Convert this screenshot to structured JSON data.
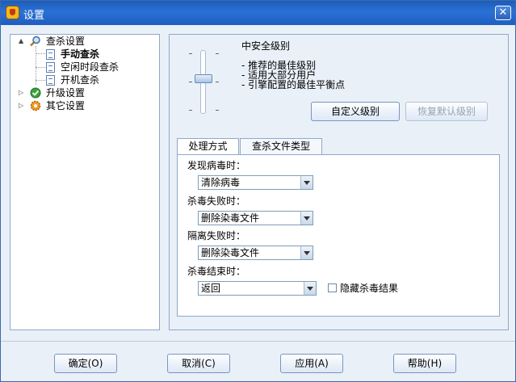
{
  "window": {
    "title": "设置",
    "close_glyph": "✕"
  },
  "tree": {
    "items": [
      {
        "label": "查杀设置",
        "expander": "▲",
        "icon": "magnifier-icon"
      },
      {
        "label": "手动查杀",
        "icon": "document-icon",
        "selected": true
      },
      {
        "label": "空闲时段查杀",
        "icon": "document-icon"
      },
      {
        "label": "开机查杀",
        "icon": "document-icon"
      },
      {
        "label": "升级设置",
        "expander": "▷",
        "icon": "green-check-icon"
      },
      {
        "label": "其它设置",
        "expander": "▷",
        "icon": "gear-icon"
      }
    ]
  },
  "security_level": {
    "title": "中安全级别",
    "bullets": [
      "- 推荐的最佳级别",
      "- 适用大部分用户",
      "- 引擎配置的最佳平衡点"
    ],
    "tick_mark": "-",
    "level_fraction": 0.5,
    "custom_button": "自定义级别",
    "restore_button": "恢复默认级别"
  },
  "tabs": [
    {
      "label": "处理方式",
      "active": true
    },
    {
      "label": "查杀文件类型",
      "active": false
    }
  ],
  "handling": {
    "found_label": "发现病毒时：",
    "found_value": "清除病毒",
    "fail_label": "杀毒失败时：",
    "fail_value": "删除染毒文件",
    "quarantine_label": "隔离失败时：",
    "quarantine_value": "删除染毒文件",
    "end_label": "杀毒结束时：",
    "end_value": "返回",
    "hide_result_label": "隐藏杀毒结果",
    "hide_result_checked": false
  },
  "footer": {
    "ok": "确定(O)",
    "cancel": "取消(C)",
    "apply": "应用(A)",
    "help": "帮助(H)"
  },
  "colors": {
    "titlebar": "#1d5bb8",
    "window_bg": "#e9f0f8",
    "border": "#8fa9c9"
  }
}
